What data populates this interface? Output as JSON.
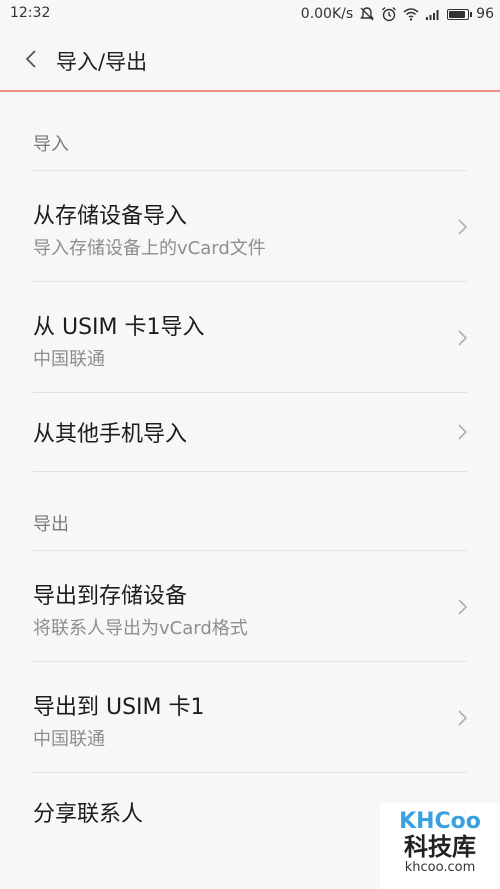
{
  "status_bar": {
    "time": "12:32",
    "network_speed": "0.00K/s",
    "battery_level": "96",
    "battery_fraction": 0.96,
    "icons": [
      "mute-icon",
      "alarm-icon",
      "wifi-icon",
      "signal-icon",
      "battery-icon"
    ]
  },
  "header": {
    "title": "导入/导出",
    "back_icon": "chevron-left-icon"
  },
  "sections": [
    {
      "title": "导入",
      "items": [
        {
          "title": "从存储设备导入",
          "subtitle": "导入存储设备上的vCard文件"
        },
        {
          "title": "从 USIM 卡1导入",
          "subtitle": "中国联通"
        },
        {
          "title": "从其他手机导入",
          "subtitle": ""
        }
      ]
    },
    {
      "title": "导出",
      "items": [
        {
          "title": "导出到存储设备",
          "subtitle": "将联系人导出为vCard格式"
        },
        {
          "title": "导出到 USIM 卡1",
          "subtitle": "中国联通"
        },
        {
          "title": "分享联系人",
          "subtitle": ""
        }
      ]
    }
  ],
  "watermark": {
    "logo": "KHCoo",
    "name": "科技库",
    "url": "khcoo.com"
  },
  "colors": {
    "accent_line": "#ee8f84",
    "background": "#f7f7f7",
    "logo": "#3aa0e0"
  }
}
